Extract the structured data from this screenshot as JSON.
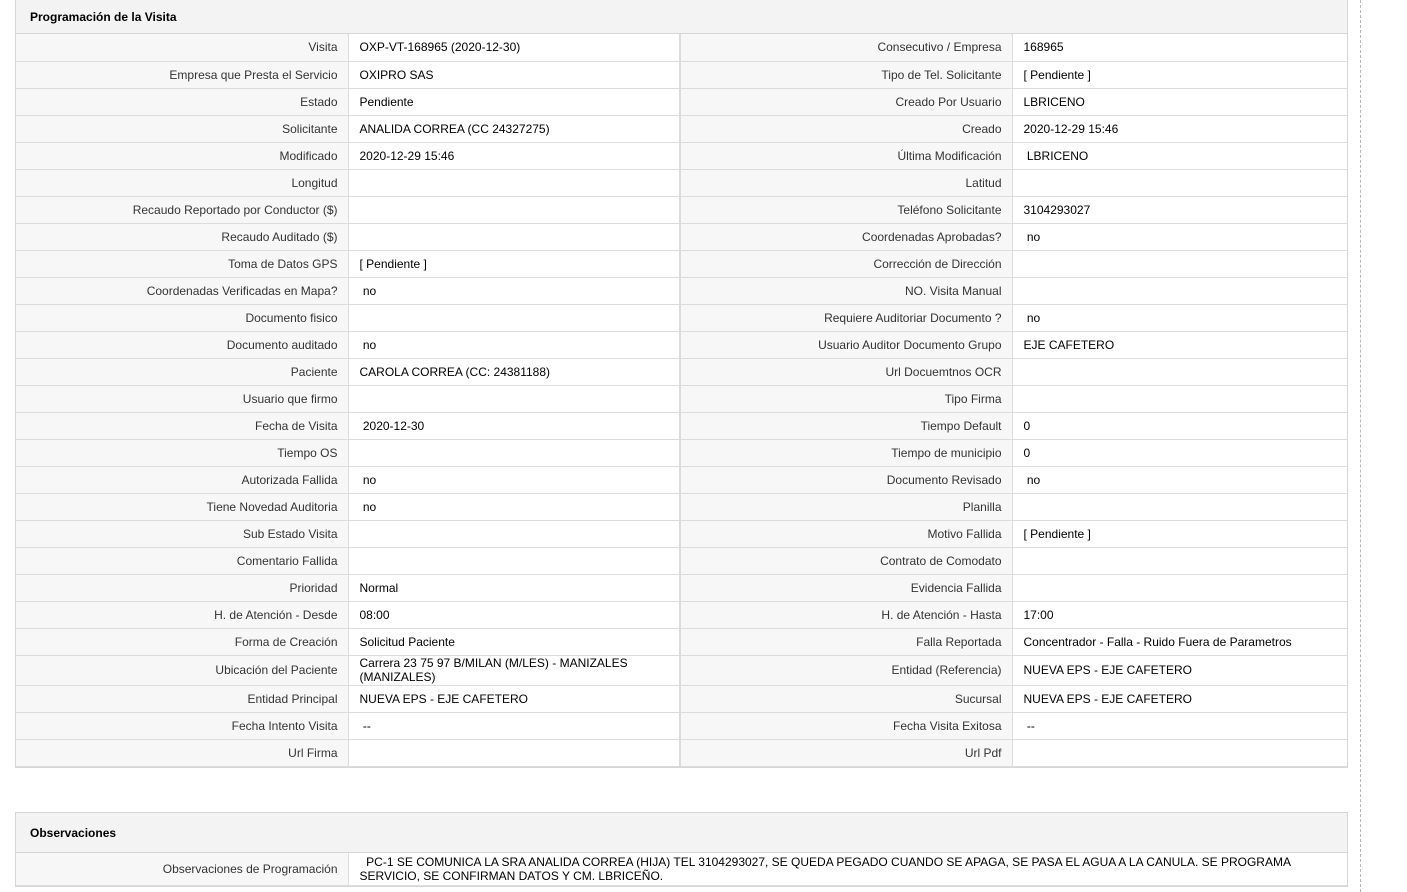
{
  "programacion": {
    "title": "Programación de la Visita",
    "rows": [
      {
        "l1": "Visita",
        "v1": "OXP-VT-168965 (2020-12-30)",
        "l2": "Consecutivo / Empresa",
        "v2": "168965"
      },
      {
        "l1": "Empresa que Presta el Servicio",
        "v1": "OXIPRO SAS",
        "l2": "Tipo de Tel. Solicitante",
        "v2": "[ Pendiente ]"
      },
      {
        "l1": "Estado",
        "v1": "Pendiente",
        "l2": "Creado Por Usuario",
        "v2": "LBRICENO"
      },
      {
        "l1": "Solicitante",
        "v1": "ANALIDA CORREA (CC 24327275)",
        "l2": "Creado",
        "v2": "2020-12-29 15:46"
      },
      {
        "l1": "Modificado",
        "v1": "2020-12-29 15:46",
        "l2": "Última Modificación",
        "v2": " LBRICENO"
      },
      {
        "l1": "Longitud",
        "v1": "",
        "l2": "Latitud",
        "v2": ""
      },
      {
        "l1": "Recaudo Reportado por Conductor ($)",
        "v1": "",
        "l2": "Teléfono Solicitante",
        "v2": "3104293027"
      },
      {
        "l1": "Recaudo Auditado ($)",
        "v1": "",
        "l2": "Coordenadas Aprobadas?",
        "v2": " no"
      },
      {
        "l1": "Toma de Datos GPS",
        "v1": "[ Pendiente ]",
        "l2": "Corrección de Dirección",
        "v2": ""
      },
      {
        "l1": "Coordenadas Verificadas en Mapa?",
        "v1": " no",
        "l2": "NO. Visita Manual",
        "v2": ""
      },
      {
        "l1": "Documento fisico",
        "v1": "",
        "l2": "Requiere Auditoriar Documento ?",
        "v2": " no"
      },
      {
        "l1": "Documento auditado",
        "v1": " no",
        "l2": "Usuario Auditor Documento Grupo",
        "v2": "EJE CAFETERO"
      },
      {
        "l1": "Paciente",
        "v1": "CAROLA CORREA (CC: 24381188)",
        "l2": "Url Docuemtnos OCR",
        "v2": ""
      },
      {
        "l1": "Usuario que firmo",
        "v1": "",
        "l2": "Tipo Firma",
        "v2": ""
      },
      {
        "l1": "Fecha de Visita",
        "v1": " 2020-12-30",
        "l2": "Tiempo Default",
        "v2": "0"
      },
      {
        "l1": "Tiempo OS",
        "v1": "",
        "l2": "Tiempo de municipio",
        "v2": "0"
      },
      {
        "l1": "Autorizada Fallida",
        "v1": " no",
        "l2": "Documento Revisado",
        "v2": " no"
      },
      {
        "l1": "Tiene Novedad Auditoria",
        "v1": " no",
        "l2": "Planilla",
        "v2": ""
      },
      {
        "l1": "Sub Estado Visita",
        "v1": "",
        "l2": "Motivo Fallida",
        "v2": "[ Pendiente ]"
      },
      {
        "l1": "Comentario Fallida",
        "v1": "",
        "l2": "Contrato de Comodato",
        "v2": ""
      },
      {
        "l1": "Prioridad",
        "v1": "Normal",
        "l2": "Evidencia Fallida",
        "v2": ""
      },
      {
        "l1": "H. de Atención - Desde",
        "v1": "08:00",
        "l2": "H. de Atención - Hasta",
        "v2": "17:00"
      },
      {
        "l1": "Forma de Creación",
        "v1": "Solicitud Paciente",
        "l2": "Falla Reportada",
        "v2": "Concentrador - Falla - Ruido Fuera de Parametros"
      },
      {
        "l1": "Ubicación del Paciente",
        "v1": "Carrera 23 75 97 B/MILAN (M/LES) - MANIZALES (MANIZALES)",
        "l2": "Entidad (Referencia)",
        "v2": "NUEVA EPS - EJE CAFETERO"
      },
      {
        "l1": "Entidad Principal",
        "v1": "NUEVA EPS - EJE CAFETERO",
        "l2": "Sucursal",
        "v2": "NUEVA EPS - EJE CAFETERO"
      },
      {
        "l1": "Fecha Intento Visita",
        "v1": " --",
        "l2": "Fecha Visita Exitosa",
        "v2": " --"
      },
      {
        "l1": "Url Firma",
        "v1": "",
        "l2": "Url Pdf",
        "v2": ""
      }
    ]
  },
  "observaciones": {
    "title": "Observaciones",
    "label": "Observaciones de Programación",
    "value": "  PC-1 SE COMUNICA LA SRA ANALIDA CORREA (HIJA) TEL 3104293027, SE QUEDA PEGADO CUANDO SE APAGA, SE PASA EL AGUA A LA CANULA. SE PROGRAMA SERVICIO, SE CONFIRMAN DATOS Y CM. LBRICEÑO."
  }
}
